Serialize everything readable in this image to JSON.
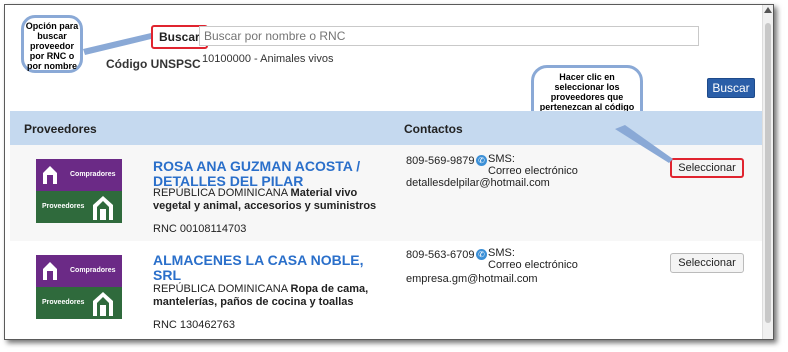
{
  "search": {
    "label": "Buscar",
    "placeholder": "Buscar por nombre o RNC"
  },
  "unspsc": {
    "label": "Código UNSPSC",
    "value": "10100000 - Animales vivos"
  },
  "search_button": "Buscar",
  "callouts": {
    "left": "Opción para buscar proveedor por RNC o por nombre",
    "right": "Hacer clic en seleccionar los proveedores que pertenezcan al código UNSPSC"
  },
  "table": {
    "headers": {
      "providers": "Proveedores",
      "contacts": "Contactos"
    },
    "rows": [
      {
        "name": "ROSA ANA GUZMAN ACOSTA / DETALLES DEL PILAR",
        "country": "REPÚBLICA DOMINICANA",
        "description": "Material vivo vegetal y animal, accesorios y suministros",
        "rnc": "RNC 00108114703",
        "phone": "809-569-9879",
        "sms": "SMS:",
        "email_label": "Correo electrónico",
        "email": "detallesdelpilar@hotmail.com",
        "select": "Seleccionar"
      },
      {
        "name": "ALMACENES LA CASA NOBLE, SRL",
        "country": "REPÚBLICA DOMINICANA",
        "description": "Ropa de cama, mantelerías, paños de cocina y toallas",
        "rnc": "RNC 130462763",
        "phone": "809-563-6709",
        "sms": "SMS:",
        "email_label": "Correo electrónico",
        "email": "empresa.gm@hotmail.com",
        "select": "Seleccionar"
      }
    ]
  },
  "logo": {
    "top_text": "Compradores",
    "bottom_text": "Proveedores"
  },
  "colors": {
    "accent": "#2a5ea8",
    "link": "#2a6fca",
    "highlight": "#e0242f",
    "header_bg": "#c5d9ef",
    "logo_purple": "#6b2a86",
    "logo_green": "#2f6a3c"
  },
  "icons": {
    "sms": "whatsapp-icon",
    "logo": "compras-logo"
  }
}
